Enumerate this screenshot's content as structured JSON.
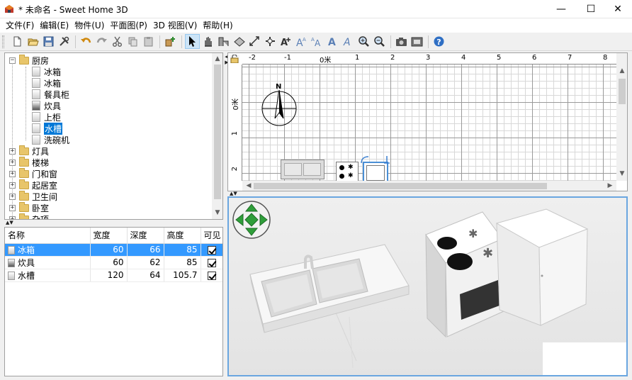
{
  "window": {
    "title": "* 未命名 - Sweet Home 3D",
    "minimize_label": "—",
    "maximize_label": "☐",
    "close_label": "✕"
  },
  "menu": [
    "文件(F)",
    "编辑(E)",
    "物件(U)",
    "平面图(P)",
    "3D 视图(V)",
    "帮助(H)"
  ],
  "toolbar": {
    "icons": [
      "new-file-icon",
      "open-folder-icon",
      "save-icon",
      "preferences-icon",
      "undo-icon",
      "redo-icon",
      "cut-icon",
      "copy-icon",
      "paste-icon",
      "add-furniture-icon",
      "select-mode-icon",
      "pan-mode-icon",
      "create-walls-icon",
      "create-rooms-icon",
      "create-dimensions-icon",
      "create-labels-icon",
      "add-text-icon",
      "increase-text-icon",
      "decrease-text-icon",
      "bold-text-icon",
      "italic-text-icon",
      "zoom-in-icon",
      "zoom-out-icon",
      "create-photo-icon",
      "create-video-icon",
      "help-icon"
    ],
    "active": "select-mode-icon"
  },
  "catalog": {
    "categories": [
      {
        "label": "厨房",
        "expanded": true,
        "items": [
          "冰箱",
          "冰箱",
          "餐具柜",
          "炊具",
          "上柜",
          "水槽",
          "洗碗机"
        ],
        "selected_item": "水槽"
      },
      {
        "label": "灯具",
        "expanded": false
      },
      {
        "label": "楼梯",
        "expanded": false
      },
      {
        "label": "门和窗",
        "expanded": false
      },
      {
        "label": "起居室",
        "expanded": false
      },
      {
        "label": "卫生间",
        "expanded": false
      },
      {
        "label": "卧室",
        "expanded": false
      },
      {
        "label": "杂项",
        "expanded": false
      }
    ]
  },
  "furniture_table": {
    "columns": [
      "名称",
      "宽度",
      "深度",
      "高度",
      "可见"
    ],
    "rows": [
      {
        "name": "冰箱",
        "width": "60",
        "depth": "66",
        "height": "85",
        "visible": true,
        "selected": true
      },
      {
        "name": "炊具",
        "width": "60",
        "depth": "62",
        "height": "85",
        "visible": true,
        "selected": false
      },
      {
        "name": "水槽",
        "width": "120",
        "depth": "64",
        "height": "105.7",
        "visible": true,
        "selected": false
      }
    ]
  },
  "plan": {
    "ruler_x": [
      "-2",
      "-1",
      "0米",
      "1",
      "2",
      "3",
      "4",
      "5",
      "6",
      "7",
      "8"
    ],
    "ruler_y": [
      "0米",
      "1",
      "2"
    ],
    "compass_label": "N"
  }
}
